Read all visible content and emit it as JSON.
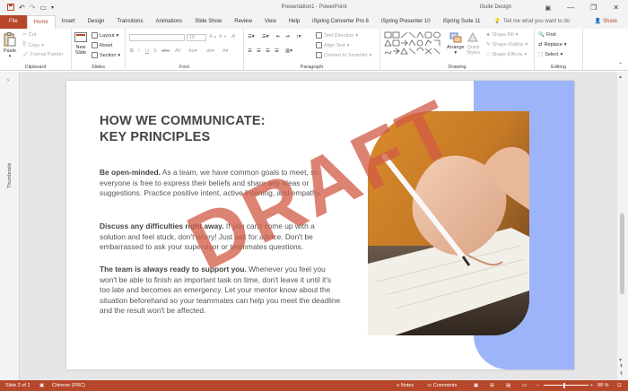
{
  "window": {
    "title": "Presentation1 - PowerPoint",
    "user": "iSuite Design",
    "minimize": "—",
    "restore": "❐",
    "close": "✕"
  },
  "tabs": [
    "File",
    "Home",
    "Insert",
    "Design",
    "Transitions",
    "Animations",
    "Slide Show",
    "Review",
    "View",
    "Help",
    "iSpring Converter Pro 8",
    "iSpring Presenter 10",
    "iSpring Suite 11"
  ],
  "active_tab": "Home",
  "tell_me": "Tell me what you want to do",
  "share": "Share",
  "ribbon": {
    "clipboard": {
      "label": "Clipboard",
      "paste": "Paste",
      "cut": "Cut",
      "copy": "Copy",
      "format_painter": "Format Painter"
    },
    "slides": {
      "label": "Slides",
      "new_slide": "New",
      "new_slide2": "Slide",
      "layout": "Layout",
      "reset": "Reset",
      "section": "Section"
    },
    "font": {
      "label": "Font",
      "size": "18"
    },
    "paragraph": {
      "label": "Paragraph",
      "text_direction": "Text Direction",
      "align_text": "Align Text",
      "convert_smartart": "Convert to SmartArt"
    },
    "drawing": {
      "label": "Drawing",
      "arrange": "Arrange",
      "quick_styles": "Quick",
      "quick_styles2": "Styles",
      "shape_fill": "Shape Fill",
      "shape_outline": "Shape Outline",
      "shape_effects": "Shape Effects"
    },
    "editing": {
      "label": "Editing",
      "find": "Find",
      "replace": "Replace",
      "select": "Select"
    }
  },
  "thumbnails_label": "Thumbnails",
  "slide": {
    "heading_line1": "HOW WE COMMUNICATE:",
    "heading_line2": "KEY PRINCIPLES",
    "p1_bold": "Be open-minded.",
    "p1_text": " As a team, we have common goals to meet, so everyone is free to express their beliefs and share any ideas or suggestions. Practice positive intent, active listening, and empathy.",
    "p2_bold": "Discuss any difficulties right away.",
    "p2_text": " If you can't come up with a solution and feel stuck, don't worry! Just ask for advice. Don't be embarrassed to ask your supervisor or teammates questions.",
    "p3_bold": "The team is always ready to support you.",
    "p3_text": " Whenever you feel you won't be able to finish an important task on time, don't leave it until it's too late and becomes an emergency. Let your mentor know about the situation beforehand so your teammates can help you meet the deadline and the result won't be affected.",
    "watermark": "DRAFT"
  },
  "status": {
    "slide": "Slide 2 of 2",
    "language": "Chinese (PRC)",
    "notes": "Notes",
    "comments": "Comments",
    "zoom": "88 %"
  },
  "colors": {
    "accent": "#b7472a",
    "blue_panel": "#9db4fa"
  }
}
